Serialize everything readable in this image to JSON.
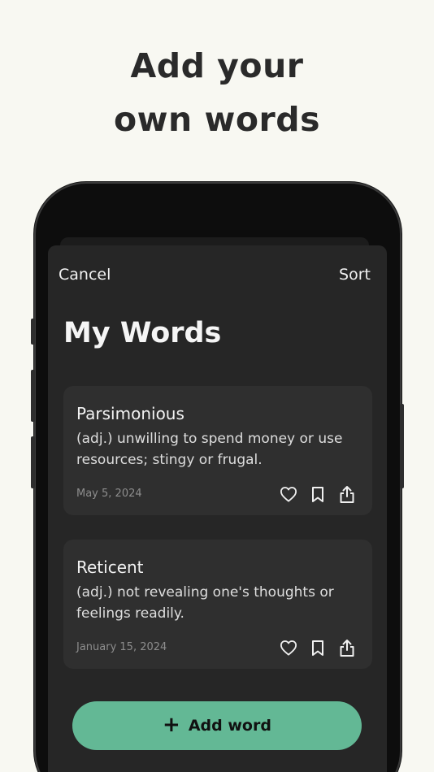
{
  "headline": {
    "line1": "Add your",
    "line2": "own words"
  },
  "nav": {
    "cancel_label": "Cancel",
    "sort_label": "Sort"
  },
  "page_title": "My Words",
  "words": [
    {
      "word": "Parsimonious",
      "definition": "(adj.) unwilling to spend money or use resources; stingy or frugal.",
      "date": "May 5, 2024"
    },
    {
      "word": "Reticent",
      "definition": "(adj.) not revealing one's thoughts or feelings readily.",
      "date": "January 15, 2024"
    }
  ],
  "add_button": {
    "label": "Add word",
    "icon": "plus-icon"
  },
  "colors": {
    "page_bg": "#f8f8f2",
    "screen_bg": "#262626",
    "card_bg": "#2f2f2f",
    "accent": "#63b895"
  },
  "card_icons": [
    "heart-icon",
    "bookmark-icon",
    "share-icon"
  ]
}
